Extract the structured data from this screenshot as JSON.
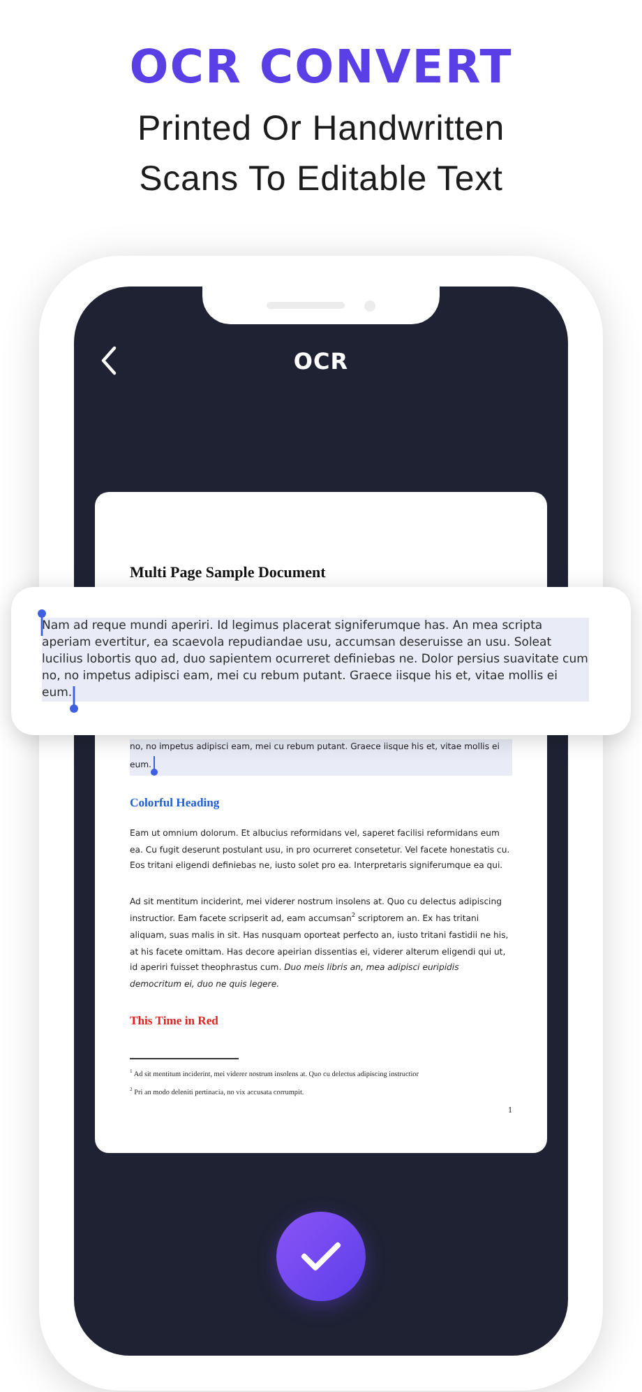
{
  "promo": {
    "title": "OCR CONVERT",
    "subtitle": "Printed Or Handwritten Scans To Editable Text"
  },
  "screen": {
    "title": "OCR"
  },
  "document": {
    "blocks": [
      {
        "kind": "title",
        "text": "Multi Page Sample Document"
      },
      {
        "kind": "paragraph",
        "text": "no, no impetus adipisci eam, mei cu rebum putant. Graece iisque his et, vitae mollis ei eum.",
        "selected": true
      },
      {
        "kind": "heading",
        "text": "Colorful Heading",
        "color": "#1f5fd6"
      },
      {
        "kind": "paragraph",
        "text": "Eam ut omnium dolorum. Et albucius reformidans vel, saperet facilisi reformidans eum ea. Cu fugit deserunt postulant usu, in pro ocurreret consetetur. Vel facete honestatis cu. Eos tritani eligendi definiebas ne, iusto solet pro ea. Interpretaris signiferumque ea qui.",
        "selected": false
      },
      {
        "kind": "paragraph",
        "text": "Ad sit mentitum inciderint, mei viderer nostrum insolens at. Quo cu delectus adipiscing instructior. Eam facete scripserit ad, eam accumsan$^{2}$ scriptorem an. Ex has tritani aliquam, suas malis in sit. Has nusquam oporteat perfecto an, iusto tritani fastidii ne his, at his facete omittam. Has decore apeirian dissentias ei, viderer alterum eligendi qui ut, id aperiri fuisset theophrastus cum. *Duo meis libris an, mea adipisci euripidis democritum ei, duo ne quis legere.*",
        "selected": false
      },
      {
        "kind": "heading",
        "text": "This Time in Red",
        "color": "#e3231f"
      },
      {
        "kind": "rule"
      },
      {
        "kind": "footnote",
        "text": "$^{1}$ Ad sit mentitum inciderint, mei viderer nostrum insolens at. Quo cu delectus adipiscing instructior"
      },
      {
        "kind": "footnote",
        "text": "$^{2}$ Pri an modo deleniti pertinacia, no vix accusata corrumpit."
      },
      {
        "kind": "page_number",
        "text": "1"
      }
    ]
  },
  "selection_popup": {
    "text": "Nam ad reque mundi aperiri. Id legimus placerat signiferumque has. An mea scripta aperiam evertitur, ea scaevola repudiandae usu, accumsan deseruisse an usu. Soleat lucilius lobortis quo ad, duo sapientem ocurreret definiebas ne. Dolor persius suavitate cum no, no impetus adipisci eam, mei cu rebum putant. Graece iisque his et, vitae mollis ei eum.",
    "selected": true
  }
}
